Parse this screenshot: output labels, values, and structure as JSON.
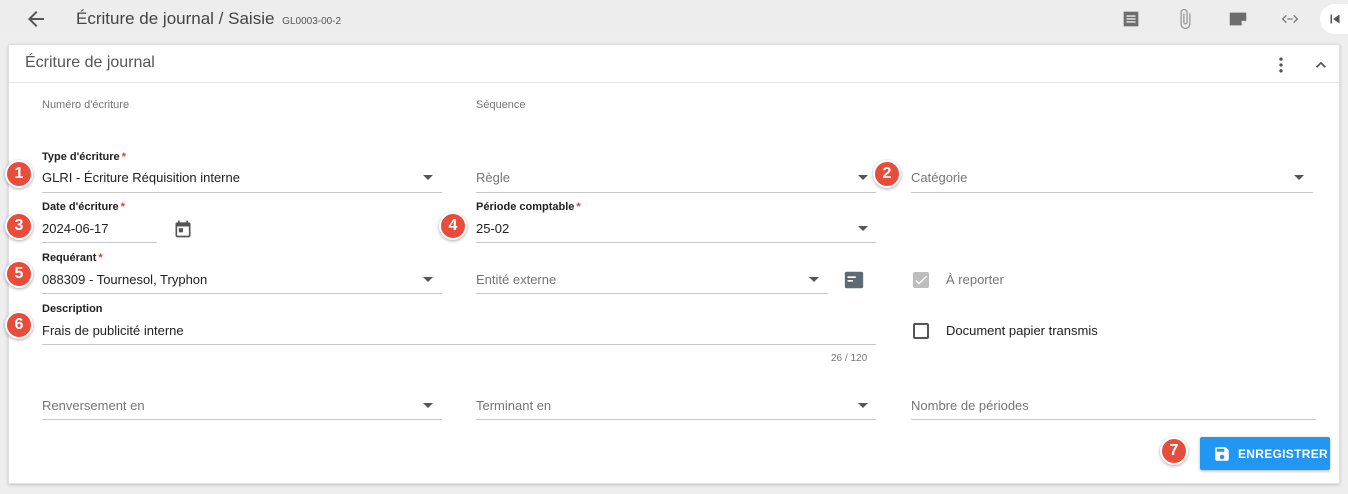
{
  "topbar": {
    "title": "Écriture de journal / Saisie",
    "code": "GL0003-00-2",
    "icons": [
      "arrow-back-icon",
      "list-icon",
      "attachment-icon",
      "note-icon",
      "code-icon",
      "first-page-icon"
    ]
  },
  "card": {
    "title": "Écriture de journal"
  },
  "fields": {
    "numero_label": "Numéro d'écriture",
    "sequence_label": "Séquence",
    "type_label": "Type d'écriture",
    "type_value": "GLRI - Écriture Réquisition interne",
    "regle_placeholder": "Règle",
    "categorie_placeholder": "Catégorie",
    "date_label": "Date d'écriture",
    "date_value": "2024-06-17",
    "periode_label": "Période comptable",
    "periode_value": "25-02",
    "requerant_label": "Requérant",
    "requerant_value": "088309 - Tournesol, Tryphon",
    "entite_placeholder": "Entité externe",
    "description_label": "Description",
    "description_value": "Frais de publicité interne",
    "description_counter": "26 / 120",
    "renversement_placeholder": "Renversement en",
    "terminant_placeholder": "Terminant en",
    "nombre_placeholder": "Nombre de périodes",
    "required_mark": "*"
  },
  "checkboxes": {
    "a_reporter": {
      "label": "À reporter",
      "checked": true,
      "disabled": true
    },
    "document_papier": {
      "label": "Document papier transmis",
      "checked": false
    }
  },
  "actions": {
    "save_label": "ENREGISTRER"
  },
  "badges": [
    "1",
    "2",
    "3",
    "4",
    "5",
    "6",
    "7"
  ],
  "colors": {
    "accent": "#2196f3",
    "badge": "#e74c3c",
    "required": "#e53935"
  }
}
